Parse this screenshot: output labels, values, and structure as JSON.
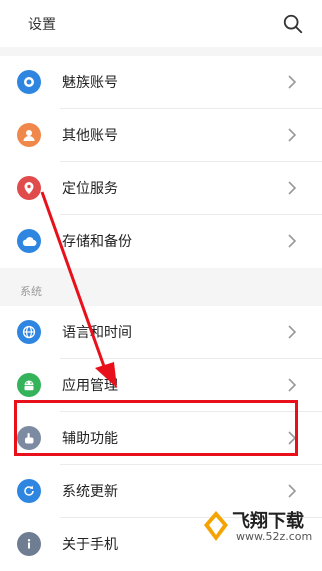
{
  "header": {
    "title": "设置"
  },
  "items_top": [
    {
      "label": "魅族账号",
      "icon": "user-badge-icon",
      "color": "#2f86e0"
    },
    {
      "label": "其他账号",
      "icon": "person-icon",
      "color": "#f0884b"
    },
    {
      "label": "定位服务",
      "icon": "location-pin-icon",
      "color": "#e04b4b"
    },
    {
      "label": "存储和备份",
      "icon": "cloud-icon",
      "color": "#2f86e0"
    }
  ],
  "section": {
    "title": "系统"
  },
  "items_system": [
    {
      "label": "语言和时间",
      "icon": "globe-icon",
      "color": "#2f86e0"
    },
    {
      "label": "应用管理",
      "icon": "android-icon",
      "color": "#34b35a"
    },
    {
      "label": "辅助功能",
      "icon": "hand-icon",
      "color": "#7d8ba2"
    },
    {
      "label": "系统更新",
      "icon": "refresh-icon",
      "color": "#2f86e0"
    },
    {
      "label": "关于手机",
      "icon": "info-icon",
      "color": "#6f7d92"
    }
  ],
  "watermark": {
    "text": "飞翔下载",
    "url": "www.52z.com"
  },
  "colors": {
    "highlight": "#e8101b",
    "background": "#f5f5f5"
  }
}
